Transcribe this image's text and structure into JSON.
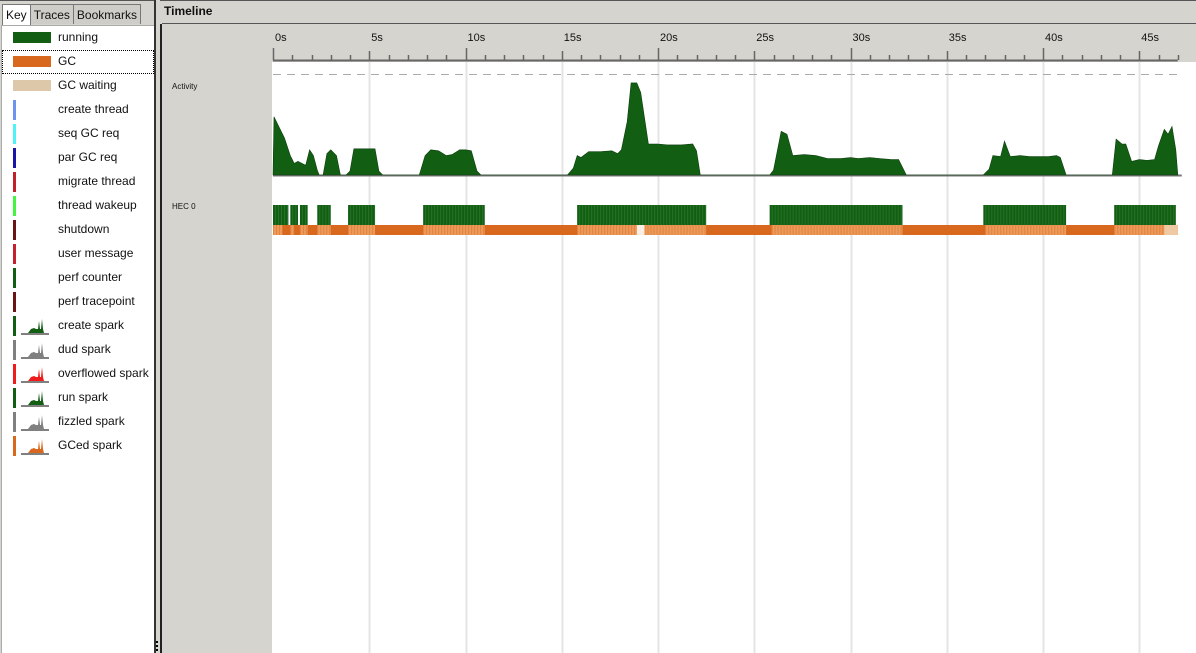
{
  "left_panel": {
    "tabs": [
      {
        "label": "Key",
        "active": true
      },
      {
        "label": "Traces",
        "active": false
      },
      {
        "label": "Bookmarks",
        "active": false
      }
    ],
    "key_items": [
      {
        "label": "running",
        "swatch": "bar",
        "color": "#125f14"
      },
      {
        "label": "GC",
        "swatch": "bar",
        "color": "#d9681f",
        "focused": true
      },
      {
        "label": "GC waiting",
        "swatch": "bar",
        "color": "#ddc9a9"
      },
      {
        "label": "create thread",
        "swatch": "line",
        "color": "#6f94f0"
      },
      {
        "label": "seq GC req",
        "swatch": "line",
        "color": "#4ff2f7"
      },
      {
        "label": "par GC req",
        "swatch": "line",
        "color": "#1b14a8"
      },
      {
        "label": "migrate thread",
        "swatch": "line",
        "color": "#c0202b"
      },
      {
        "label": "thread wakeup",
        "swatch": "line",
        "color": "#43f542"
      },
      {
        "label": "shutdown",
        "swatch": "line",
        "color": "#6b1414"
      },
      {
        "label": "user message",
        "swatch": "line",
        "color": "#c42030"
      },
      {
        "label": "perf counter",
        "swatch": "line",
        "color": "#125f14"
      },
      {
        "label": "perf tracepoint",
        "swatch": "line",
        "color": "#6b1414"
      },
      {
        "label": "create spark",
        "swatch": "spark",
        "color": "#125f14"
      },
      {
        "label": "dud spark",
        "swatch": "spark",
        "color": "#808080"
      },
      {
        "label": "overflowed spark",
        "swatch": "spark",
        "color": "#ee1c1c"
      },
      {
        "label": "run spark",
        "swatch": "spark",
        "color": "#125f14"
      },
      {
        "label": "fizzled spark",
        "swatch": "spark",
        "color": "#808080"
      },
      {
        "label": "GCed spark",
        "swatch": "spark",
        "color": "#d9681f"
      }
    ]
  },
  "timeline": {
    "title": "Timeline",
    "row_labels": {
      "activity": "Activity",
      "hec0": "HEC 0"
    },
    "colors": {
      "running": "#125f14",
      "gc": "#d9681f",
      "gc_light": "#eb9a5a"
    },
    "axis": {
      "unit": "s",
      "start": 0,
      "end": 47,
      "major_step": 5,
      "minor_step": 1,
      "tick_labels": [
        "0s",
        "5s",
        "10s",
        "15s",
        "20s",
        "25s",
        "30s",
        "35s",
        "40s",
        "45s"
      ]
    },
    "activity": {
      "max": 1.0,
      "points": [
        [
          0.0,
          0.0
        ],
        [
          0.05,
          0.6
        ],
        [
          0.3,
          0.5
        ],
        [
          0.6,
          0.38
        ],
        [
          0.9,
          0.2
        ],
        [
          1.1,
          0.12
        ],
        [
          1.3,
          0.14
        ],
        [
          1.5,
          0.12
        ],
        [
          1.7,
          0.1
        ],
        [
          1.9,
          0.26
        ],
        [
          2.1,
          0.2
        ],
        [
          2.3,
          0.05
        ],
        [
          2.4,
          0.0
        ],
        [
          2.6,
          0.0
        ],
        [
          2.8,
          0.22
        ],
        [
          3.0,
          0.26
        ],
        [
          3.3,
          0.2
        ],
        [
          3.5,
          0.0
        ],
        [
          3.8,
          0.0
        ],
        [
          4.0,
          0.04
        ],
        [
          4.2,
          0.27
        ],
        [
          5.1,
          0.27
        ],
        [
          5.3,
          0.27
        ],
        [
          5.5,
          0.04
        ],
        [
          5.7,
          0.0
        ],
        [
          7.6,
          0.0
        ],
        [
          7.9,
          0.2
        ],
        [
          8.2,
          0.26
        ],
        [
          8.6,
          0.25
        ],
        [
          9.0,
          0.2
        ],
        [
          9.3,
          0.21
        ],
        [
          9.7,
          0.26
        ],
        [
          10.0,
          0.26
        ],
        [
          10.3,
          0.25
        ],
        [
          10.6,
          0.04
        ],
        [
          10.8,
          0.0
        ],
        [
          15.3,
          0.0
        ],
        [
          15.6,
          0.07
        ],
        [
          15.8,
          0.2
        ],
        [
          16.0,
          0.18
        ],
        [
          16.4,
          0.24
        ],
        [
          17.0,
          0.24
        ],
        [
          17.6,
          0.25
        ],
        [
          17.9,
          0.22
        ],
        [
          18.1,
          0.26
        ],
        [
          18.4,
          0.55
        ],
        [
          18.6,
          0.95
        ],
        [
          18.9,
          0.95
        ],
        [
          19.1,
          0.85
        ],
        [
          19.5,
          0.32
        ],
        [
          20.0,
          0.32
        ],
        [
          20.5,
          0.31
        ],
        [
          21.2,
          0.31
        ],
        [
          21.8,
          0.32
        ],
        [
          22.0,
          0.25
        ],
        [
          22.2,
          0.0
        ],
        [
          25.8,
          0.0
        ],
        [
          26.0,
          0.05
        ],
        [
          26.4,
          0.45
        ],
        [
          26.7,
          0.42
        ],
        [
          27.0,
          0.2
        ],
        [
          27.6,
          0.21
        ],
        [
          28.2,
          0.2
        ],
        [
          28.8,
          0.17
        ],
        [
          29.5,
          0.17
        ],
        [
          30.0,
          0.18
        ],
        [
          30.4,
          0.17
        ],
        [
          31.0,
          0.18
        ],
        [
          31.5,
          0.17
        ],
        [
          32.1,
          0.16
        ],
        [
          32.5,
          0.16
        ],
        [
          32.9,
          0.0
        ],
        [
          36.9,
          0.0
        ],
        [
          37.2,
          0.06
        ],
        [
          37.4,
          0.2
        ],
        [
          37.8,
          0.19
        ],
        [
          38.0,
          0.35
        ],
        [
          38.3,
          0.19
        ],
        [
          38.8,
          0.2
        ],
        [
          39.3,
          0.19
        ],
        [
          39.8,
          0.19
        ],
        [
          40.3,
          0.19
        ],
        [
          40.7,
          0.2
        ],
        [
          40.9,
          0.18
        ],
        [
          41.2,
          0.0
        ],
        [
          43.6,
          0.0
        ],
        [
          43.8,
          0.37
        ],
        [
          44.1,
          0.32
        ],
        [
          44.3,
          0.32
        ],
        [
          44.6,
          0.14
        ],
        [
          45.0,
          0.16
        ],
        [
          45.4,
          0.15
        ],
        [
          45.8,
          0.16
        ],
        [
          46.0,
          0.3
        ],
        [
          46.3,
          0.47
        ],
        [
          46.5,
          0.42
        ],
        [
          46.7,
          0.5
        ],
        [
          46.9,
          0.26
        ],
        [
          47.0,
          0.0
        ]
      ]
    },
    "hec0": {
      "running_intervals": [
        [
          0.0,
          0.8
        ],
        [
          0.9,
          1.3
        ],
        [
          1.4,
          1.8
        ],
        [
          2.3,
          3.0
        ],
        [
          3.9,
          5.3
        ],
        [
          7.8,
          11.0
        ],
        [
          15.8,
          22.5
        ],
        [
          25.8,
          32.7
        ],
        [
          36.9,
          41.2
        ],
        [
          43.7,
          46.9
        ]
      ],
      "gc_interval": [
        0.0,
        47.0
      ],
      "gc_light_intervals": [
        [
          0.0,
          0.5
        ],
        [
          0.9,
          1.1
        ],
        [
          1.4,
          1.8
        ],
        [
          2.3,
          3.0
        ],
        [
          3.9,
          5.3
        ],
        [
          7.8,
          11.0
        ],
        [
          15.8,
          18.9
        ],
        [
          19.3,
          22.5
        ],
        [
          25.9,
          32.7
        ],
        [
          37.0,
          41.2
        ],
        [
          43.7,
          46.8
        ]
      ],
      "gc_white_intervals": [
        [
          18.9,
          19.3
        ]
      ],
      "gc_waiting_intervals": [
        [
          46.3,
          47.0
        ]
      ]
    }
  }
}
